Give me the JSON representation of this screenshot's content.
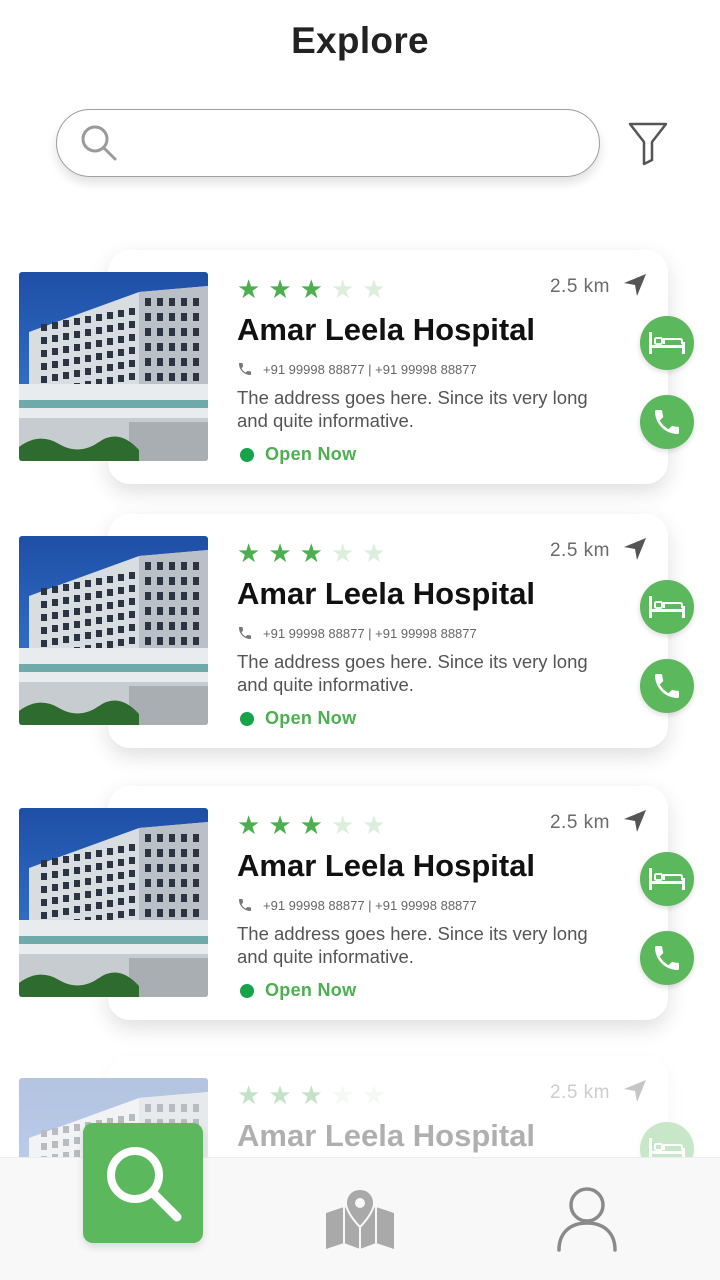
{
  "header": {
    "title": "Explore"
  },
  "search": {
    "value": "",
    "placeholder": ""
  },
  "cards": [
    {
      "name": "Amar Leela Hospital",
      "rating": 3,
      "max_rating": 5,
      "distance": "2.5 km",
      "phone": "+91 99998 88877 | +91 99998 88877",
      "address": "The address goes here. Since its very long and quite informative.",
      "status": "Open Now"
    },
    {
      "name": "Amar Leela Hospital",
      "rating": 3,
      "max_rating": 5,
      "distance": "2.5 km",
      "phone": "+91 99998 88877 | +91 99998 88877",
      "address": "The address goes here. Since its very long and quite informative.",
      "status": "Open Now"
    },
    {
      "name": "Amar Leela Hospital",
      "rating": 3,
      "max_rating": 5,
      "distance": "2.5 km",
      "phone": "+91 99998 88877 | +91 99998 88877",
      "address": "The address goes here. Since its very long and quite informative.",
      "status": "Open Now"
    },
    {
      "name": "Amar Leela Hospital",
      "rating": 3,
      "max_rating": 5,
      "distance": "2.5 km"
    }
  ],
  "icons": {
    "search": "search-icon",
    "filter": "filter-icon",
    "navigate": "navigation-arrow-icon",
    "bed": "bed-icon",
    "call": "phone-icon",
    "map": "map-icon",
    "profile": "user-icon"
  },
  "colors": {
    "accent": "#5cb85c",
    "status_open": "#17a34a",
    "star_filled": "#4caf50",
    "star_empty": "#dcefdc"
  },
  "bottom_nav": {
    "active": "search"
  }
}
